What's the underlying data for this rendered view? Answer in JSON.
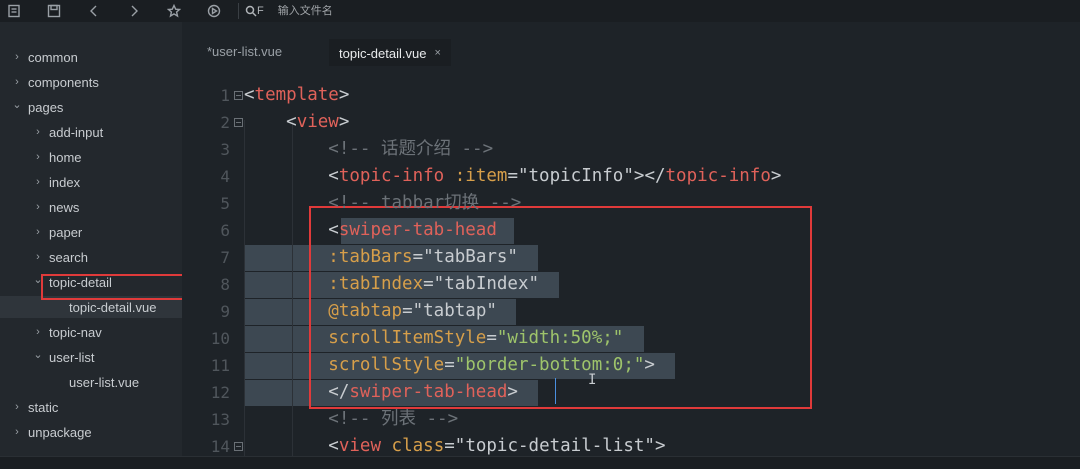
{
  "toolbar": {
    "icons": [
      "new-file-icon",
      "save-icon",
      "back-icon",
      "forward-icon",
      "star-icon",
      "run-icon"
    ],
    "search_shortcut": "F",
    "search_placeholder": "输入文件名"
  },
  "sidebar": {
    "items": [
      {
        "label": "common",
        "arrow": "›",
        "level": 0
      },
      {
        "label": "components",
        "arrow": "›",
        "level": 0
      },
      {
        "label": "pages",
        "arrow": "⌄",
        "level": 0
      },
      {
        "label": "add-input",
        "arrow": "›",
        "level": 1
      },
      {
        "label": "home",
        "arrow": "›",
        "level": 1
      },
      {
        "label": "index",
        "arrow": "›",
        "level": 1
      },
      {
        "label": "news",
        "arrow": "›",
        "level": 1
      },
      {
        "label": "paper",
        "arrow": "›",
        "level": 1
      },
      {
        "label": "search",
        "arrow": "›",
        "level": 1
      },
      {
        "label": "topic-detail",
        "arrow": "⌄",
        "level": 1
      },
      {
        "label": "topic-detail.vue",
        "arrow": "",
        "level": 2
      },
      {
        "label": "topic-nav",
        "arrow": "›",
        "level": 1
      },
      {
        "label": "user-list",
        "arrow": "⌄",
        "level": 1
      },
      {
        "label": "user-list.vue",
        "arrow": "",
        "level": 2
      },
      {
        "label": "static",
        "arrow": "›",
        "level": 0
      },
      {
        "label": "unpackage",
        "arrow": "›",
        "level": 0
      }
    ]
  },
  "tabs": [
    {
      "label": "*user-list.vue",
      "active": false
    },
    {
      "label": "topic-detail.vue",
      "active": true,
      "close": "×"
    }
  ],
  "editor": {
    "line_numbers": [
      "1",
      "2",
      "3",
      "4",
      "5",
      "6",
      "7",
      "8",
      "9",
      "10",
      "11",
      "12",
      "13",
      "14"
    ],
    "lines": [
      "<template>",
      "    <view>",
      "        <!-- 话题介绍 -->",
      "        <topic-info :item=\"topicInfo\"></topic-info>",
      "        <!-- tabbar切换 -->",
      "        <swiper-tab-head",
      "        :tabBars=\"tabBars\"",
      "        :tabIndex=\"tabIndex\"",
      "        @tabtap=\"tabtap\"",
      "        scrollItemStyle=\"width:50%;\"",
      "        scrollStyle=\"border-bottom:0;\">",
      "        </swiper-tab-head>",
      "        <!-- 列表 -->",
      "        <view class=\"topic-detail-list\">"
    ]
  },
  "colors": {
    "background": "#1e2328",
    "sidebar": "#23282d",
    "tag": "#e0625a",
    "attribute": "#d79f4a",
    "string_value": "#9ec46b",
    "comment": "#6c7278",
    "highlight_box": "#e03a3a",
    "selection": "#3d4852"
  }
}
